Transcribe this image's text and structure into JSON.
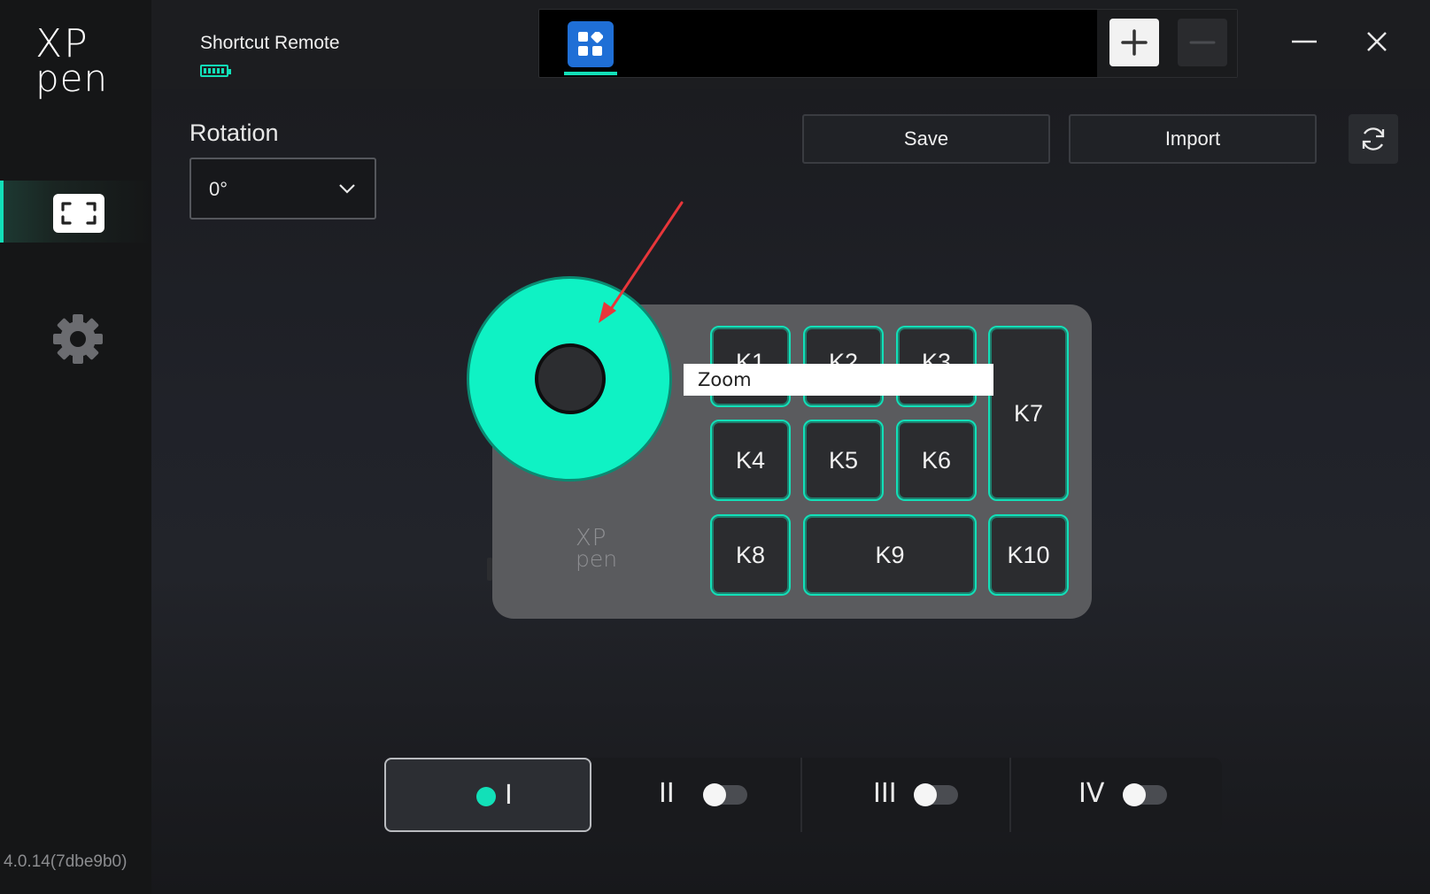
{
  "app": {
    "device_name": "Shortcut Remote",
    "version": "4.0.14(7dbe9b0)",
    "accent_color": "#12e0b8",
    "brand_blue": "#1f6fd6"
  },
  "logo": {
    "line1": "XP",
    "line2": "pen"
  },
  "sidebar": {
    "items": [
      {
        "icon": "fullscreen-frame-icon",
        "active": true
      },
      {
        "icon": "gear-icon",
        "active": false
      }
    ]
  },
  "header": {
    "app_tile_icon": "app-grid-icon",
    "add_icon": "plus-icon",
    "remove_icon": "minus-icon",
    "window_controls": [
      "minimize-icon",
      "close-icon"
    ]
  },
  "toolbar": {
    "rotation_label": "Rotation",
    "rotation_value": "0°",
    "save_label": "Save",
    "import_label": "Import",
    "reset_icon": "refresh-icon"
  },
  "device": {
    "dial_color": "#0ff2c4",
    "tooltip": "Zoom",
    "keys": {
      "k1": "K1",
      "k2": "K2",
      "k3": "K3",
      "k4": "K4",
      "k5": "K5",
      "k6": "K6",
      "k7": "K7",
      "k8": "K8",
      "k9": "K9",
      "k10": "K10"
    },
    "body_logo": {
      "line1": "XP",
      "line2": "pen"
    }
  },
  "profiles": [
    {
      "label": "I",
      "active": true
    },
    {
      "label": "II",
      "enabled": false
    },
    {
      "label": "III",
      "enabled": false
    },
    {
      "label": "IV",
      "enabled": false
    }
  ]
}
